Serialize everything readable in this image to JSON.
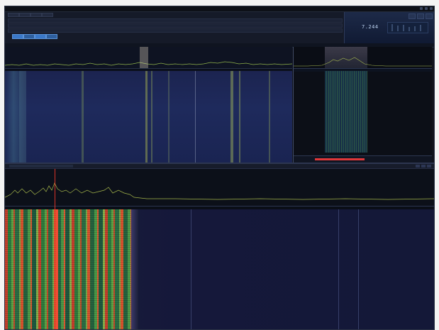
{
  "window": {
    "title": ""
  },
  "frequency": {
    "main": "7.244",
    "secondary": ""
  },
  "colors": {
    "accent": "#3a78c8",
    "meter": "#e0383a",
    "waterfall_hot": "#c8402c",
    "waterfall_bg": "#1c2450"
  },
  "icons": {
    "window_controls": [
      "minimize-icon",
      "maximize-icon",
      "close-icon"
    ]
  }
}
